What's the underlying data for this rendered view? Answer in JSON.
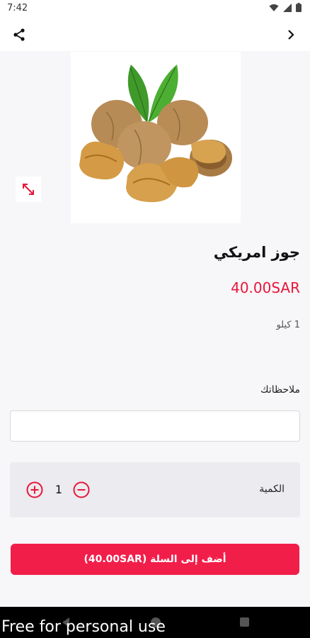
{
  "status": {
    "time": "7:42"
  },
  "product": {
    "title": "جوز امريكي",
    "price": "40.00SAR",
    "unit": "1 كيلو"
  },
  "notes": {
    "label": "ملاحظاتك",
    "value": "",
    "placeholder": ""
  },
  "quantity": {
    "label": "الكمية",
    "value": "1"
  },
  "add_to_cart": {
    "label": "أضف إلى السلة (40.00SAR)"
  },
  "watermark": "Free for personal use",
  "colors": {
    "accent": "#f21e4a",
    "price": "#e8173b",
    "background": "#f7f6f8"
  },
  "icons": [
    "share-icon",
    "chevron-right-icon",
    "expand-icon",
    "plus-circle-icon",
    "minus-circle-icon",
    "wifi-icon",
    "signal-icon",
    "battery-icon"
  ]
}
